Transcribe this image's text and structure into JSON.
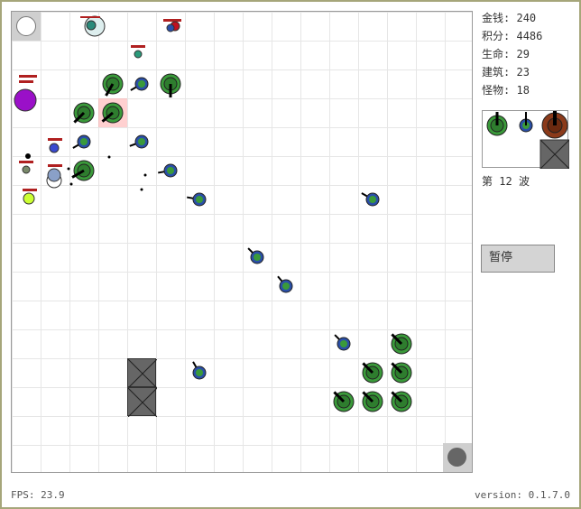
{
  "stats": {
    "money_label": "金钱:",
    "money": "240",
    "score_label": "积分:",
    "score": "4486",
    "life_label": "生命:",
    "life": "29",
    "buildings_label": "建筑:",
    "buildings": "23",
    "monsters_label": "怪物:",
    "monsters": "18"
  },
  "wave": {
    "prefix": "第",
    "number": "12",
    "suffix": "波"
  },
  "pause_button": "暂停",
  "fps": "FPS: 23.9",
  "version": "version: 0.1.7.0",
  "colors": {
    "cannon_fill": "#3a9a3a",
    "blue_fill": "#2a4fa8",
    "heavy_fill": "#8b3a1a",
    "wall": "#666666",
    "highlight": "#ffaaaa"
  },
  "palette_items": [
    "cannon-tower",
    "blue-tower",
    "heavy-tower",
    "wall"
  ]
}
